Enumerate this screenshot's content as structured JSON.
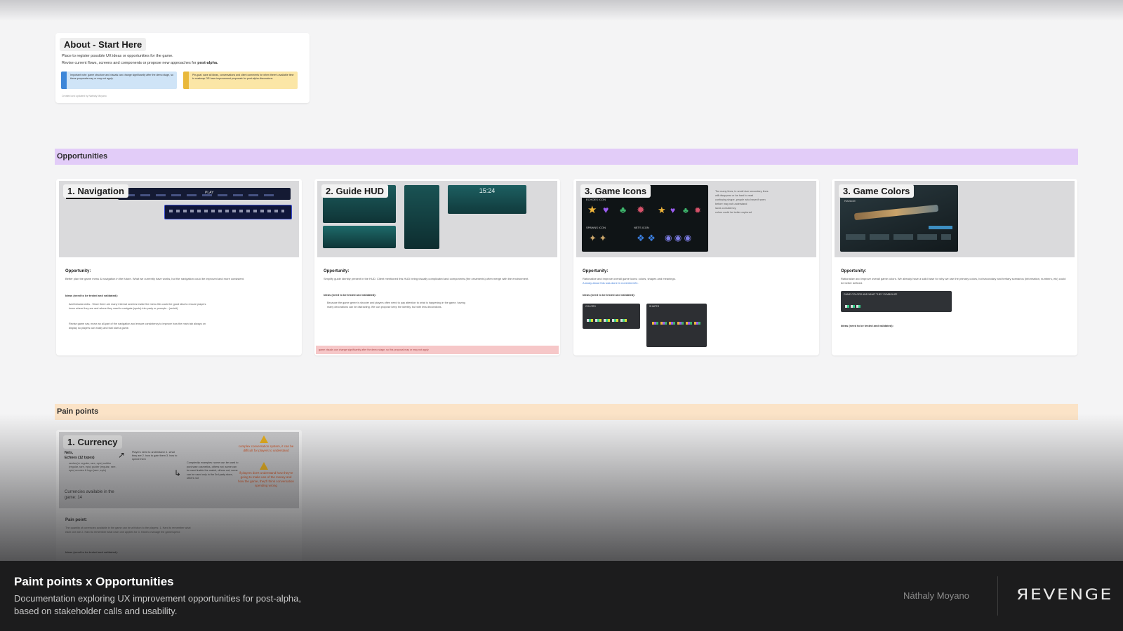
{
  "about": {
    "title": "About - Start Here",
    "line1": "Place to register possible UX ideas or opportunities for the game.",
    "line2": "Revise current flows, screens and components or propose new approaches for ",
    "line2_bold": "post-alpha.",
    "callout_info": "Important note: game structure and visuals can change significantly after the demo stage, so these proposals may or may not apply.",
    "callout_warn": "Pin-goal: save all ideas, conversations and client comments for when there's available time to roadmap OR have improvement proposals for post-alpha discussions.",
    "credit": "Created and updated by Náthaly Moyano"
  },
  "sections": {
    "opportunities": "Opportunities",
    "pain_points": "Pain points"
  },
  "cards": [
    {
      "title": "1. Navigation",
      "opp_label": "Opportunity:",
      "opp_text": "Better plan the game menu & navigation in the future. What we currently have works, but the navigation could be improved and more consistent.",
      "ideas": "Ideas (need to be tested and validated):",
      "bullets": [
        "Add breadcrumbs - Since there are many internal screens inside the menu this could be good idea to ensure players know where they are and where they want to navigate (spots) into party or prompts - (revisit)",
        "Revise game nav, move an all-part of the navigation and ensure consistency to improve how the main tab always on display so players can easily and fast start a game."
      ],
      "hud_time": ""
    },
    {
      "title": "2. Guide HUD",
      "opp_label": "Opportunity:",
      "opp_text": "Simplify guide identity present in the HUD. Client mentioned this HUD being visually complicated and components (the ornaments) often merge with the environment.",
      "ideas": "Ideas (need to be tested and validated):",
      "bullets": [
        "Because the game genre is shooter and players often need to pay attention to what is happening in the game, having many decorations can be distracting. We can propose keep the identity, but with less decorations."
      ],
      "hud_time": "15:24",
      "note": "game visuals can change significantly after the demo stage, so this proposal may or may not apply"
    },
    {
      "title": "3. Game Icons",
      "opp_label": "Opportunity:",
      "opp_text": "Rationalize and improve overall game icons: colors, shapes and meanings.",
      "study": "A study about this was done in november/24.",
      "ideas": "Ideas (need to be tested and validated):",
      "side_notes": [
        "Too many lines, in small size secondary lines will disappear or be hard to read",
        "confusing shape, people who haven't seen before may not understand",
        "lacks consistency",
        "colors could be better explored"
      ],
      "icon_labels": [
        "ECHOES ICON",
        "SPAWNS ICON",
        "NETS ICON"
      ],
      "sub_labels": [
        "COLORS",
        "SHAPES"
      ]
    },
    {
      "title": "3. Game Colors",
      "opp_label": "Opportunity:",
      "opp_text": "Rationalize and improve overall game colors. We already have a solid base for why we use the primary colors, but secondary and tertiary scenarios (information, numbers, etc) could be better defined.",
      "ideas": "Ideas (need to be tested and validated):",
      "weapon_label": "RAVAGE",
      "sub_label": "GAME COLORS AND WHAT THEY SYMBOLIZE"
    }
  ],
  "pain": {
    "title": "1. Currency",
    "list": [
      "Nets,",
      "Echoes (12 types)"
    ],
    "types": "seeker(re regular, rare, epic) soldier (regular, rare, epic) guider (regular, rare, epic) emotes & logo (rare, epic)",
    "available": "Currencies available in the game: 14",
    "need": "Players need to understand: 1. what they are 2. how to gain them 3. how to spend them",
    "examples": "Complexity examples: some can be used to purchase cosmetics, others not; some can be used inside the match, others not; some can be used only in the 3rd party store, others not",
    "warn1": "complex conversation system, it can be difficult for players to understand",
    "warn2": "if players don't understand how they're going to make use of the money and how the game, they'll think conversation spending wrong",
    "label": "Pain point:",
    "text": "The quantity of currencies available in the game can be a friction to the players: 1. Hard to remember what each one are 2. Hard to remember what each one applies for 3. Hard to manage the game/spend",
    "ideas": "Ideas (need to be tested and validated):"
  },
  "footer": {
    "title": "Paint points x Opportunities",
    "description": "Documentation exploring UX improvement opportunities for post-alpha, based on stakeholder calls and usability.",
    "author": "Náthaly Moyano",
    "logo": "ЯEVENGE"
  },
  "colors": {
    "opportunities_band": "#e2ccf8",
    "pain_band": "#fbe3c7",
    "footer_bg": "#1c1c1d"
  }
}
